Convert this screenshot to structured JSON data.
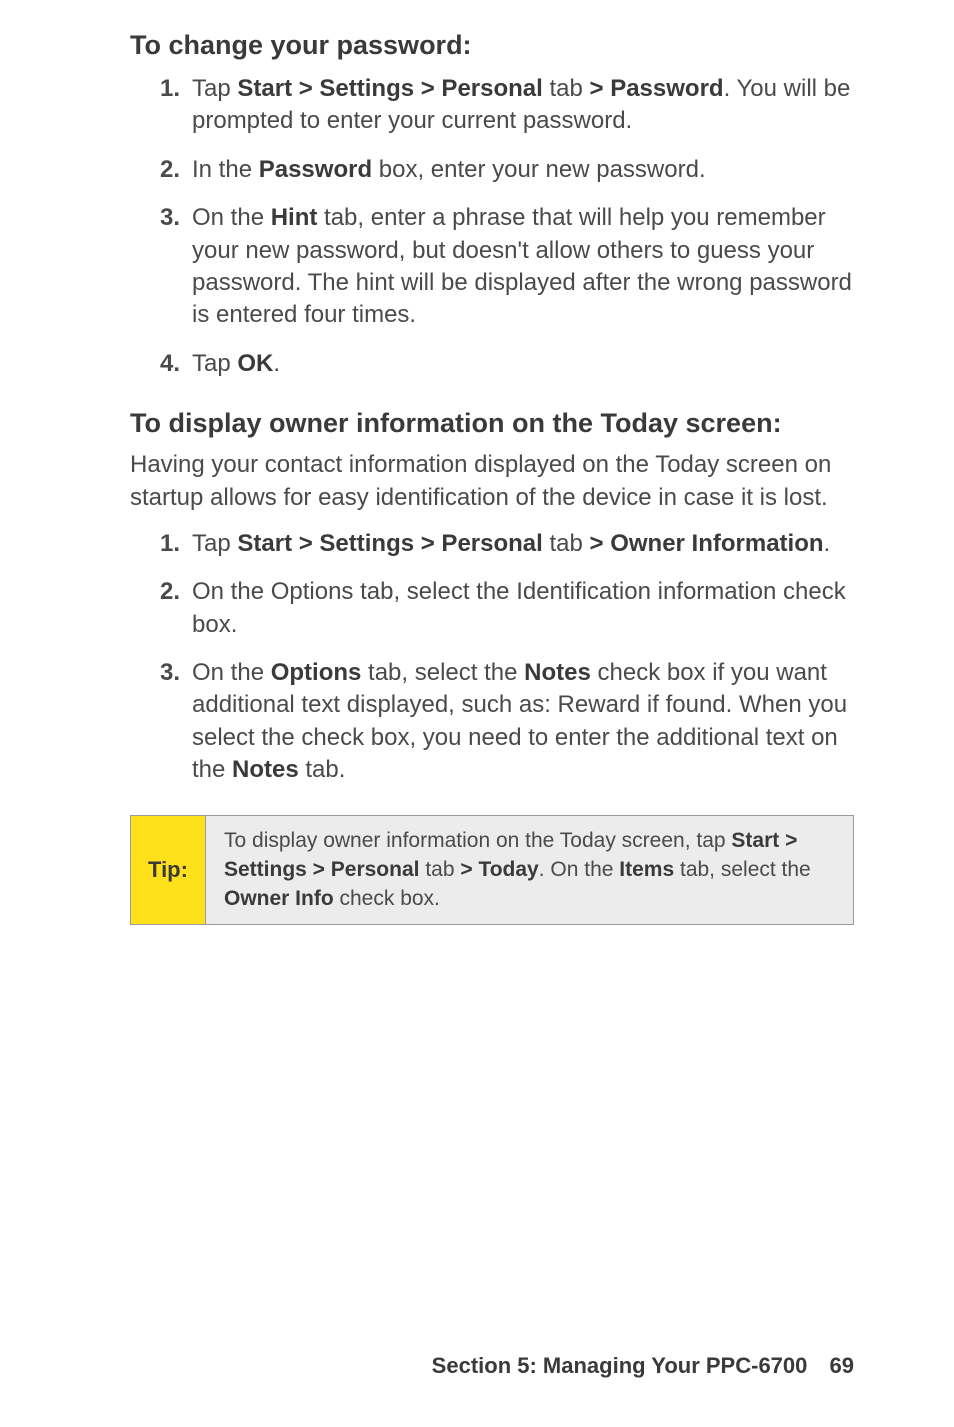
{
  "section1": {
    "title": "To change your password:",
    "steps": [
      {
        "num": "1.",
        "html": "Tap <b>Start &gt; Settings &gt; Personal</b> tab <b>&gt; Password</b>. You will be prompted to enter your current password."
      },
      {
        "num": "2.",
        "html": "In the <b>Password</b> box, enter your new password."
      },
      {
        "num": "3.",
        "html": "On the <b>Hint</b> tab, enter a phrase that will help you remember your new password, but doesn't allow others to guess your password. The hint will be displayed after the wrong password is entered four times."
      },
      {
        "num": "4.",
        "html": "Tap <b>OK</b>."
      }
    ]
  },
  "section2": {
    "title": "To display owner information on the Today screen:",
    "intro": "Having your contact information displayed on the Today screen on startup allows for easy identification of the device in case it is lost.",
    "steps": [
      {
        "num": "1.",
        "html": "Tap <b>Start &gt; Settings &gt; Personal</b> tab <b>&gt; Owner Information</b>."
      },
      {
        "num": "2.",
        "html": "On the Options tab, select the Identification information check box."
      },
      {
        "num": "3.",
        "html": "On the <b>Options</b> tab, select the <b>Notes</b> check box if you want additional text displayed, such as: Reward if found. When you select the check box, you need to enter the additional text on the <b>Notes</b> tab."
      }
    ]
  },
  "tip": {
    "label": "Tip:",
    "html": "To display owner information on the Today screen, tap <b>Start &gt; Settings &gt; Personal</b> tab <b>&gt; Today</b>. On the <b>Items</b> tab, select the <b>Owner Info</b> check box."
  },
  "footer": {
    "text": "Section 5: Managing Your PPC-6700",
    "page": "69"
  }
}
